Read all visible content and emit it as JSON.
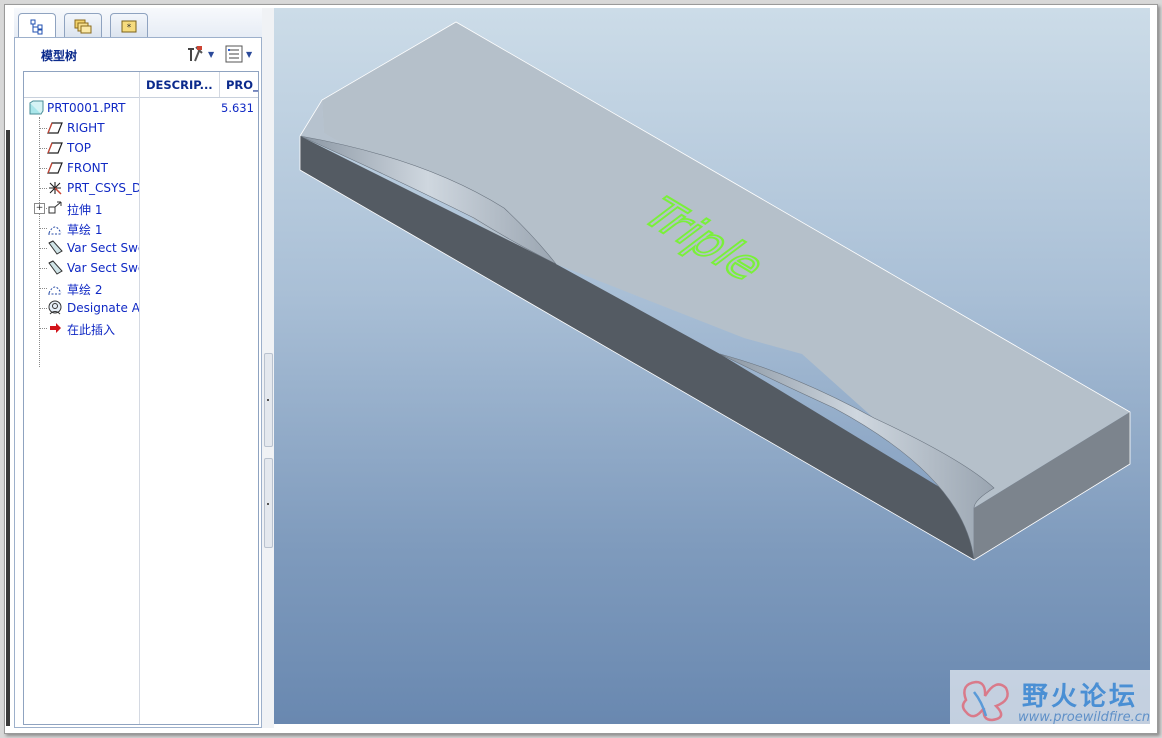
{
  "tabs": [
    {
      "icon": "model-tree-icon",
      "active": true
    },
    {
      "icon": "folder-browser-icon",
      "active": false
    },
    {
      "icon": "favorites-icon",
      "active": false
    }
  ],
  "panel": {
    "title": "模型树",
    "settings_icon": "tree-settings-icon",
    "show_icon": "tree-columns-icon"
  },
  "columns": [
    "DESCRIP...",
    "PRO_"
  ],
  "tree": {
    "root": {
      "label": "PRT0001.PRT",
      "value": "5.631",
      "icon": "part-icon"
    },
    "items": [
      {
        "label": "RIGHT",
        "icon": "datum-plane-icon"
      },
      {
        "label": "TOP",
        "icon": "datum-plane-icon"
      },
      {
        "label": "FRONT",
        "icon": "datum-plane-icon"
      },
      {
        "label": "PRT_CSYS_D",
        "icon": "coordinate-system-icon"
      },
      {
        "label": "拉伸 1",
        "icon": "extrude-icon"
      },
      {
        "label": "草绘 1",
        "icon": "sketch-icon"
      },
      {
        "label": "Var Sect Swe",
        "icon": "sweep-icon"
      },
      {
        "label": "Var Sect Swe",
        "icon": "sweep-icon"
      },
      {
        "label": "草绘 2",
        "icon": "sketch-icon"
      },
      {
        "label": "Designate A",
        "icon": "designate-icon"
      },
      {
        "label": "在此插入",
        "icon": "insert-here-arrow-icon"
      }
    ]
  },
  "model": {
    "text": "Triple",
    "text_color": "#7af03a",
    "top_color": "#b5c0ca",
    "front_color": "#545b63",
    "end_color": "#7c848d"
  },
  "watermark": {
    "name": "野火论坛",
    "url": "www.proewildfire.cn"
  }
}
